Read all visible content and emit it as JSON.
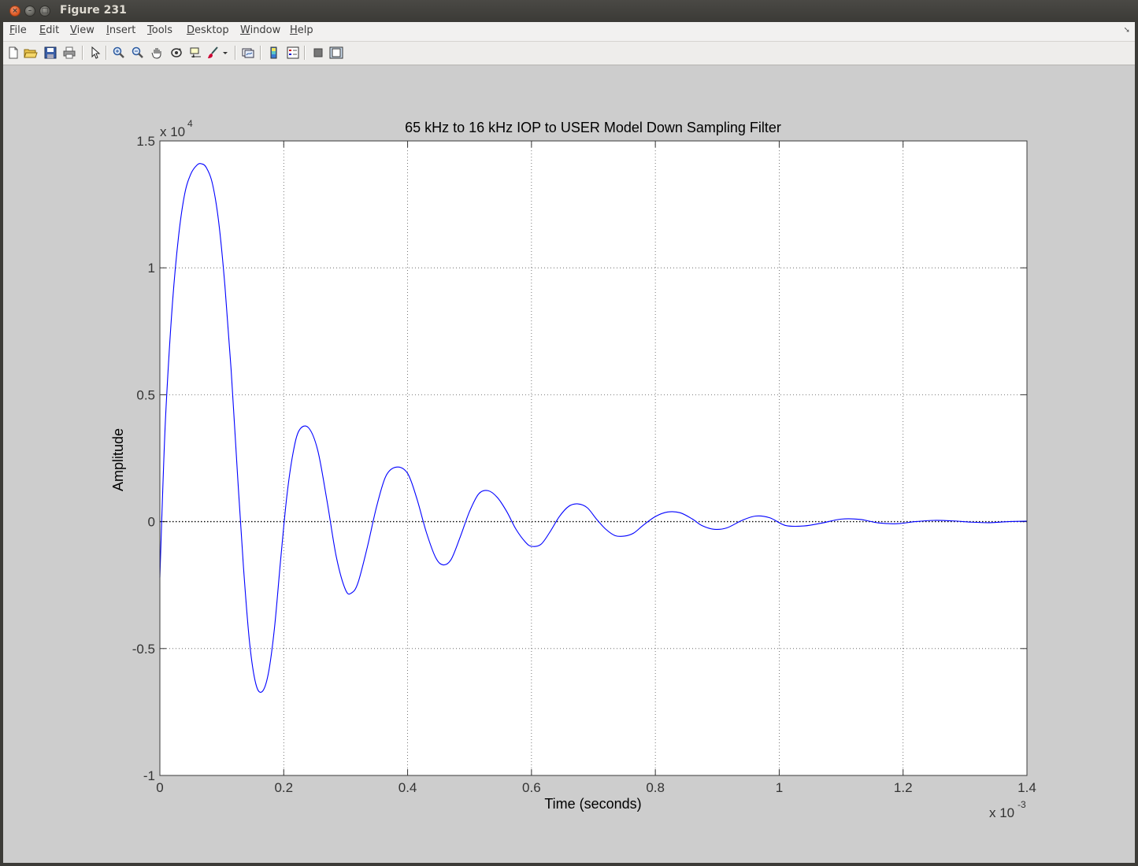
{
  "window": {
    "title": "Figure 231"
  },
  "menu": {
    "items": [
      {
        "label": "File",
        "mnemonic": "F"
      },
      {
        "label": "Edit",
        "mnemonic": "E"
      },
      {
        "label": "View",
        "mnemonic": "V"
      },
      {
        "label": "Insert",
        "mnemonic": "I"
      },
      {
        "label": "Tools",
        "mnemonic": "T"
      },
      {
        "label": "Desktop",
        "mnemonic": "D"
      },
      {
        "label": "Window",
        "mnemonic": "W"
      },
      {
        "label": "Help",
        "mnemonic": "H"
      }
    ]
  },
  "toolbar": {
    "buttons": [
      {
        "icon": "new-figure-icon"
      },
      {
        "icon": "open-file-icon"
      },
      {
        "icon": "save-icon"
      },
      {
        "icon": "print-icon"
      },
      {
        "icon": "edit-plot-arrow-icon"
      },
      {
        "icon": "zoom-in-icon"
      },
      {
        "icon": "zoom-out-icon"
      },
      {
        "icon": "pan-hand-icon"
      },
      {
        "icon": "rotate-3d-icon"
      },
      {
        "icon": "data-cursor-icon"
      },
      {
        "icon": "brush-icon"
      },
      {
        "icon": "link-plot-icon"
      },
      {
        "icon": "insert-colorbar-icon"
      },
      {
        "icon": "insert-legend-icon"
      },
      {
        "icon": "hide-plot-tools-icon"
      },
      {
        "icon": "show-plot-tools-icon"
      }
    ]
  },
  "chart_data": {
    "type": "line",
    "title": "65 kHz to 16 kHz IOP to USER Model Down Sampling Filter",
    "xlabel": "Time (seconds)",
    "ylabel": "Amplitude",
    "x_exponent_label": "x 10",
    "x_exponent": "-3",
    "y_exponent_label": "x 10",
    "y_exponent": "4",
    "xlim": [
      0,
      1.4
    ],
    "ylim": [
      -1,
      1.5
    ],
    "x_ticks": [
      "0",
      "0.2",
      "0.4",
      "0.6",
      "0.8",
      "1",
      "1.2",
      "1.4"
    ],
    "y_ticks": [
      "-1",
      "-0.5",
      "0",
      "0.5",
      "1",
      "1.5"
    ],
    "grid": true,
    "line_color": "#0000ff",
    "zero_line": true,
    "series": [
      {
        "x": [
          0,
          0.005,
          0.01,
          0.02,
          0.03,
          0.04,
          0.05,
          0.06,
          0.067,
          0.075,
          0.085,
          0.095,
          0.105,
          0.115,
          0.125,
          0.135,
          0.145,
          0.155,
          0.165,
          0.175,
          0.185,
          0.195,
          0.205,
          0.215,
          0.225,
          0.24,
          0.255,
          0.27,
          0.285,
          0.3,
          0.31,
          0.32,
          0.335,
          0.35,
          0.365,
          0.382,
          0.4,
          0.415,
          0.43,
          0.445,
          0.457,
          0.47,
          0.485,
          0.5,
          0.515,
          0.53,
          0.545,
          0.56,
          0.575,
          0.59,
          0.6,
          0.615,
          0.63,
          0.645,
          0.66,
          0.675,
          0.69,
          0.705,
          0.72,
          0.735,
          0.75,
          0.765,
          0.78,
          0.8,
          0.82,
          0.84,
          0.86,
          0.875,
          0.895,
          0.915,
          0.94,
          0.962,
          0.985,
          1.01,
          1.04,
          1.07,
          1.1,
          1.13,
          1.16,
          1.19,
          1.22,
          1.25,
          1.28,
          1.31,
          1.34,
          1.37,
          1.4
        ],
        "y": [
          -0.22,
          0.15,
          0.45,
          0.85,
          1.12,
          1.29,
          1.37,
          1.405,
          1.41,
          1.395,
          1.33,
          1.18,
          0.93,
          0.6,
          0.2,
          -0.18,
          -0.48,
          -0.64,
          -0.67,
          -0.6,
          -0.42,
          -0.15,
          0.1,
          0.27,
          0.36,
          0.37,
          0.28,
          0.08,
          -0.14,
          -0.27,
          -0.28,
          -0.24,
          -0.1,
          0.06,
          0.18,
          0.215,
          0.19,
          0.09,
          -0.04,
          -0.14,
          -0.17,
          -0.15,
          -0.06,
          0.04,
          0.11,
          0.122,
          0.095,
          0.04,
          -0.03,
          -0.08,
          -0.097,
          -0.09,
          -0.04,
          0.02,
          0.06,
          0.07,
          0.055,
          0.01,
          -0.03,
          -0.055,
          -0.057,
          -0.045,
          -0.015,
          0.02,
          0.038,
          0.035,
          0.01,
          -0.015,
          -0.03,
          -0.025,
          0.005,
          0.022,
          0.015,
          -0.015,
          -0.017,
          -0.005,
          0.01,
          0.009,
          -0.005,
          -0.008,
          0.0,
          0.005,
          0.003,
          -0.002,
          -0.004,
          0.0,
          0.002
        ]
      }
    ]
  }
}
